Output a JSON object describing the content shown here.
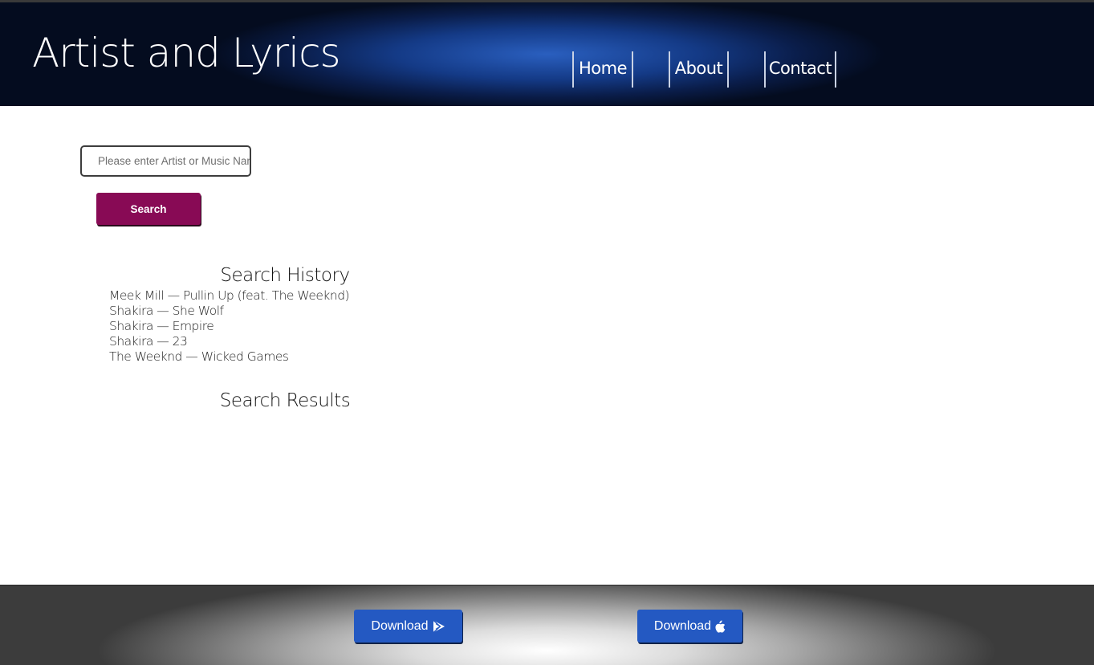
{
  "header": {
    "brand": "Artist and Lyrics",
    "nav": [
      {
        "label": "Home"
      },
      {
        "label": "About"
      },
      {
        "label": "Contact"
      }
    ]
  },
  "search": {
    "placeholder": "Please enter Artist or Music Name",
    "value": "",
    "button_label": "Search"
  },
  "history": {
    "title": "Search History",
    "items": [
      "Meek Mill — Pullin Up (feat. The Weeknd)",
      "Shakira — She Wolf",
      "Shakira — Empire",
      "Shakira — 23",
      "The Weeknd — Wicked Games"
    ]
  },
  "results": {
    "title": "Search Results",
    "items": []
  },
  "footer": {
    "download_android": {
      "label": "Download",
      "icon": "play-store-icon"
    },
    "download_apple": {
      "label": "Download",
      "icon": "apple-icon"
    }
  },
  "colors": {
    "header_blue": "#143a86",
    "search_button": "#880a55",
    "download_button": "#2459c2"
  }
}
